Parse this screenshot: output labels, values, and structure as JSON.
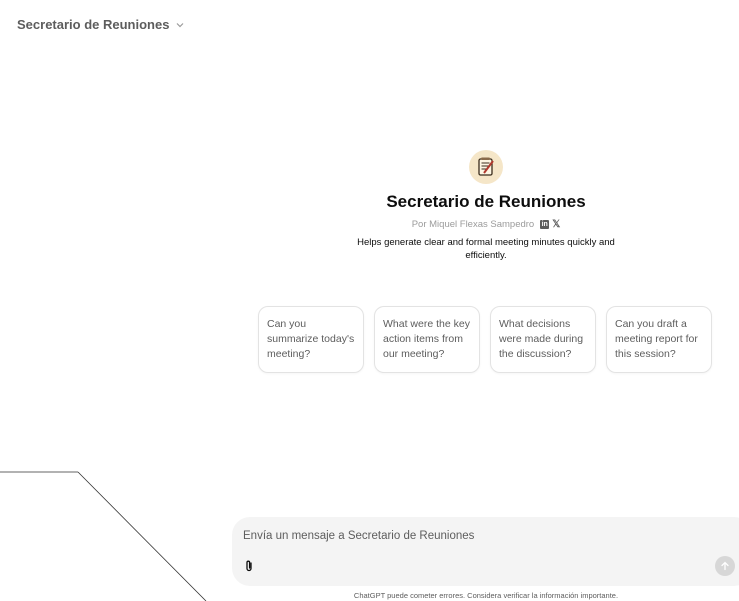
{
  "header": {
    "title": "Secretario de Reuniones",
    "icon": "chevron-down-icon"
  },
  "gpt": {
    "logo_icon": "notepad-icon",
    "name": "Secretario de Reuniones",
    "byline": "Por Miquel Flexas Sampedro",
    "social": {
      "linkedin": "in",
      "x": "𝕏"
    },
    "description": "Helps generate clear and formal meeting minutes quickly and efficiently."
  },
  "prompts": [
    {
      "label": "Can you summarize today's meeting?"
    },
    {
      "label": "What were the key action items from our meeting?"
    },
    {
      "label": "What decisions were made during the discussion?"
    },
    {
      "label": "Can you draft a meeting report for this session?"
    }
  ],
  "composer": {
    "placeholder": "Envía un mensaje a Secretario de Reuniones",
    "attach_icon": "paperclip-icon",
    "send_icon": "arrow-up-icon"
  },
  "footer": {
    "disclaimer": "ChatGPT puede cometer errores. Considera verificar la información importante."
  },
  "colors": {
    "text": "#0d0d0d",
    "muted": "#5d5d5d",
    "composer_bg": "#f4f4f4",
    "border": "#e3e3e3"
  }
}
